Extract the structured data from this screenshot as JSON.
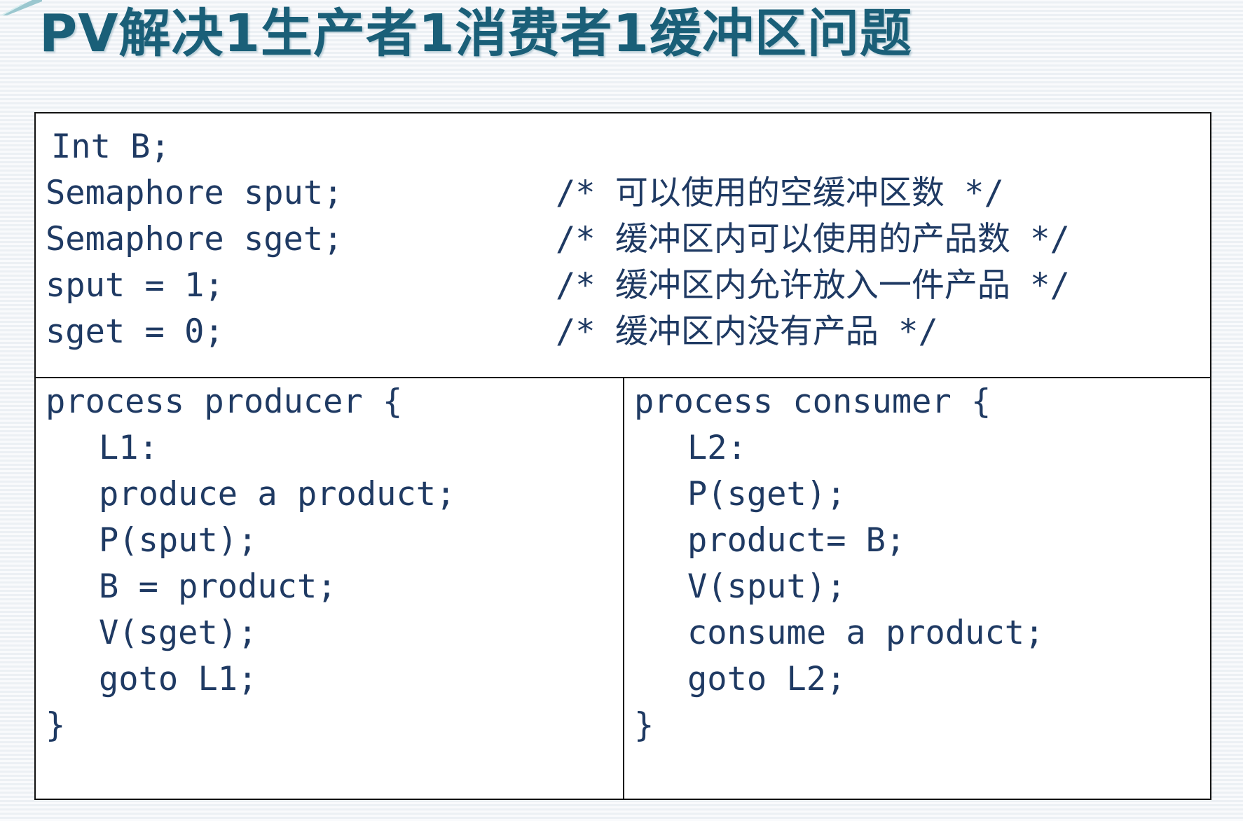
{
  "title": "PV解决1生产者1消费者1缓冲区问题",
  "declarations": [
    {
      "code": "Int B;",
      "comment": ""
    },
    {
      "code": "Semaphore sput;",
      "comment": "/* 可以使用的空缓冲区数 */"
    },
    {
      "code": "Semaphore sget;",
      "comment": "/* 缓冲区内可以使用的产品数 */"
    },
    {
      "code": "sput = 1;",
      "comment": "/* 缓冲区内允许放入一件产品 */"
    },
    {
      "code": "sget = 0;",
      "comment": "/* 缓冲区内没有产品 */"
    }
  ],
  "producer": {
    "header": "process producer {",
    "lines": [
      "L1:",
      "produce a product;",
      "P(sput);",
      "B = product;",
      "V(sget);",
      "goto L1;"
    ],
    "footer": "}"
  },
  "consumer": {
    "header": "process consumer {",
    "lines": [
      "L2:",
      "P(sget);",
      "product= B;",
      "V(sput);",
      "consume a product;",
      "goto L2;"
    ],
    "footer": "}"
  },
  "colors": {
    "title": "#1a5f78",
    "code": "#1f3a63",
    "border": "#111111"
  }
}
